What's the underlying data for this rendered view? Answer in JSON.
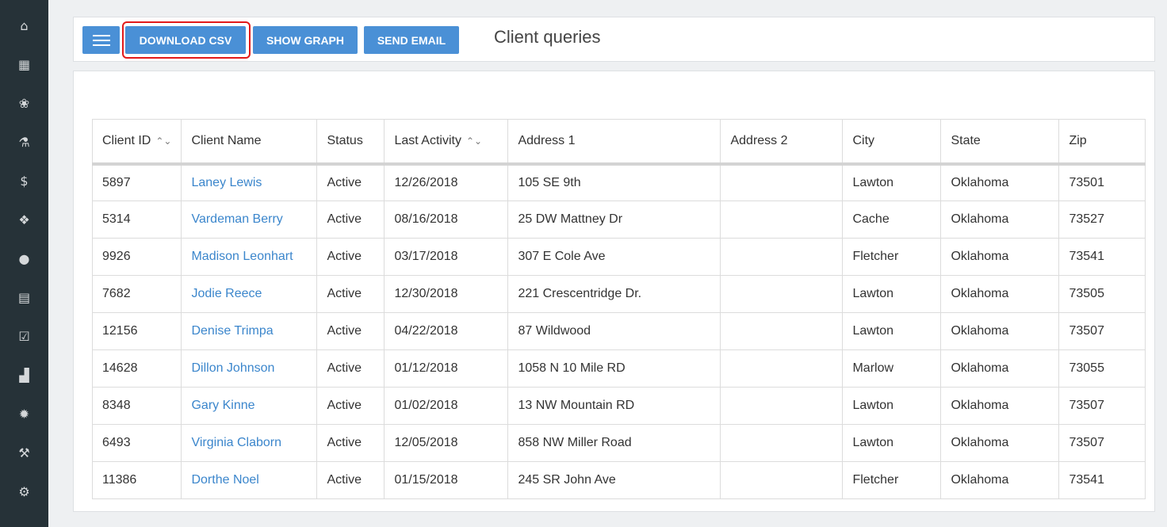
{
  "sidebar": {
    "icons": [
      "home-icon",
      "calendar-icon",
      "paw-icon",
      "flask-icon",
      "dollar-icon",
      "dropbox-icon",
      "comments-icon",
      "receipt-icon",
      "check-square-icon",
      "chart-icon",
      "gear-icon",
      "wrench-icon",
      "gears-icon"
    ]
  },
  "toolbar": {
    "menu_icon": "hamburger-icon",
    "download_csv": "DOWNLOAD CSV",
    "show_graph": "SHOW GRAPH",
    "send_email": "SEND EMAIL",
    "title": "Client queries"
  },
  "table": {
    "columns": [
      "Client ID",
      "Client Name",
      "Status",
      "Last Activity",
      "Address 1",
      "Address 2",
      "City",
      "State",
      "Zip"
    ],
    "rows": [
      [
        "5897",
        "Laney Lewis",
        "Active",
        "12/26/2018",
        "105  SE 9th",
        "",
        "Lawton",
        "Oklahoma",
        "73501"
      ],
      [
        "5314",
        "Vardeman Berry",
        "Active",
        "08/16/2018",
        "25 DW  Mattney Dr",
        "",
        "Cache",
        "Oklahoma",
        "73527"
      ],
      [
        "9926",
        "Madison Leonhart",
        "Active",
        "03/17/2018",
        "307  E Cole Ave",
        "",
        "Fletcher",
        "Oklahoma",
        "73541"
      ],
      [
        "7682",
        "Jodie Reece",
        "Active",
        "12/30/2018",
        "221  Crescentridge Dr.",
        "",
        "Lawton",
        "Oklahoma",
        "73505"
      ],
      [
        "12156",
        "Denise Trimpa",
        "Active",
        "04/22/2018",
        "87  Wildwood",
        "",
        "Lawton",
        "Oklahoma",
        "73507"
      ],
      [
        "14628",
        "Dillon Johnson",
        "Active",
        "01/12/2018",
        "1058  N 10 Mile RD",
        "",
        "Marlow",
        "Oklahoma",
        "73055"
      ],
      [
        "8348",
        "Gary Kinne",
        "Active",
        "01/02/2018",
        "13 NW Mountain RD",
        "",
        "Lawton",
        "Oklahoma",
        "73507"
      ],
      [
        "6493",
        "Virginia Claborn",
        "Active",
        "12/05/2018",
        "858 NW Miller Road",
        "",
        "Lawton",
        "Oklahoma",
        "73507"
      ],
      [
        "11386",
        "Dorthe Noel",
        "Active",
        "01/15/2018",
        "245  SR John Ave",
        "",
        "Fletcher",
        "Oklahoma",
        "73541"
      ]
    ]
  }
}
